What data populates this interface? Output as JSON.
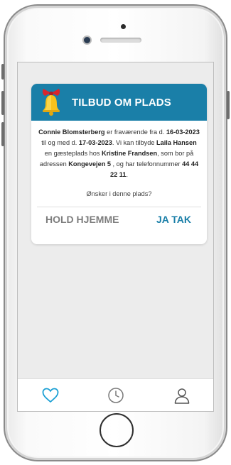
{
  "dialog": {
    "title": "TILBUD OM PLADS",
    "child_name": "Connie Blomsterberg",
    "text_absent_from": " er fraværende fra d. ",
    "date_from": "16-03-2023",
    "text_until": " til og med d. ",
    "date_to": "17-03-2023",
    "text_offer": ". Vi kan tilbyde ",
    "caretaker_name": "Laila Hansen",
    "text_guest": " en gæsteplads hos ",
    "host_name": "Kristine Frandsen",
    "text_lives": ", som bor på adressen ",
    "address": "Kongevejen 5",
    "text_phone": " , og har telefonnummer ",
    "phone": "44 44 22 11",
    "text_end": ".",
    "question": "Ønsker i denne plads?",
    "decline_label": "HOLD HJEMME",
    "accept_label": "JA TAK"
  },
  "tabbar": {
    "items": [
      {
        "icon": "heart-icon"
      },
      {
        "icon": "clock-icon"
      },
      {
        "icon": "user-icon"
      }
    ]
  },
  "colors": {
    "accent": "#1a7fa8",
    "decline": "#7d7d7d",
    "screen_bg": "#ececec"
  }
}
